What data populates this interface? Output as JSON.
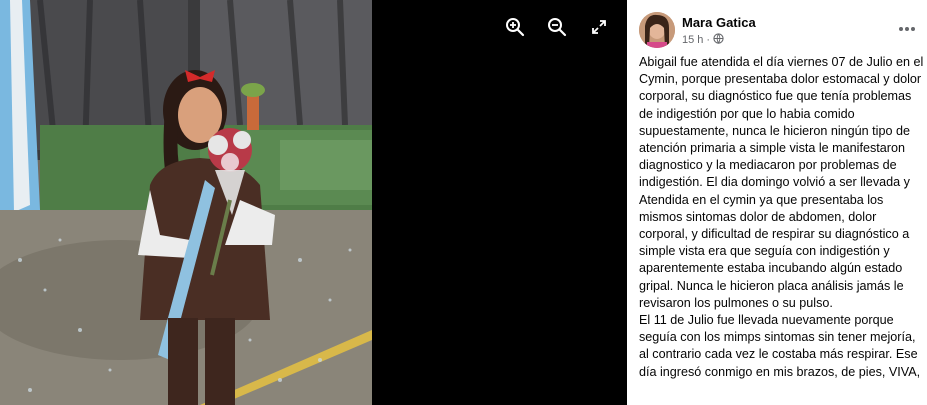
{
  "viewer": {
    "zoom_in_icon": "zoom-in-icon",
    "zoom_out_icon": "zoom-out-icon",
    "fullscreen_icon": "fullscreen-icon"
  },
  "post": {
    "author": "Mara Gatica",
    "time": "15 h",
    "separator": "·",
    "paragraphs": [
      "Abigail fue atendida el día viernes 07 de Julio en el Cymin, porque presentaba dolor estomacal y dolor corporal, su diagnóstico fue que tenía problemas de indigestión por que lo habia comido supuestamente, nunca le hicieron ningún tipo de atención primaria a simple vista le manifestaron diagnostico y la mediacaron por problemas de indigestión. El dia domingo volvió a ser llevada y Atendida en el cymin ya que presentaba los mismos sintomas dolor de abdomen, dolor corporal, y dificultad de respirar su diagnóstico a simple vista era que seguía con indigestión y aparentemente estaba incubando algún estado gripal. Nunca le hicieron placa análisis jamás le revisaron los pulmones o su pulso.",
      "El 11 de Julio fue llevada nuevamente porque seguía con los mimps sintomas sin tener mejoría, al contrario cada vez le costaba más respirar. Ese día ingresó conmigo en mis brazos, de pies, VIVA,"
    ]
  },
  "colors": {
    "panel_bg": "#ffffff",
    "text": "#050505",
    "meta": "#65676b",
    "viewer_bg": "#000000"
  }
}
